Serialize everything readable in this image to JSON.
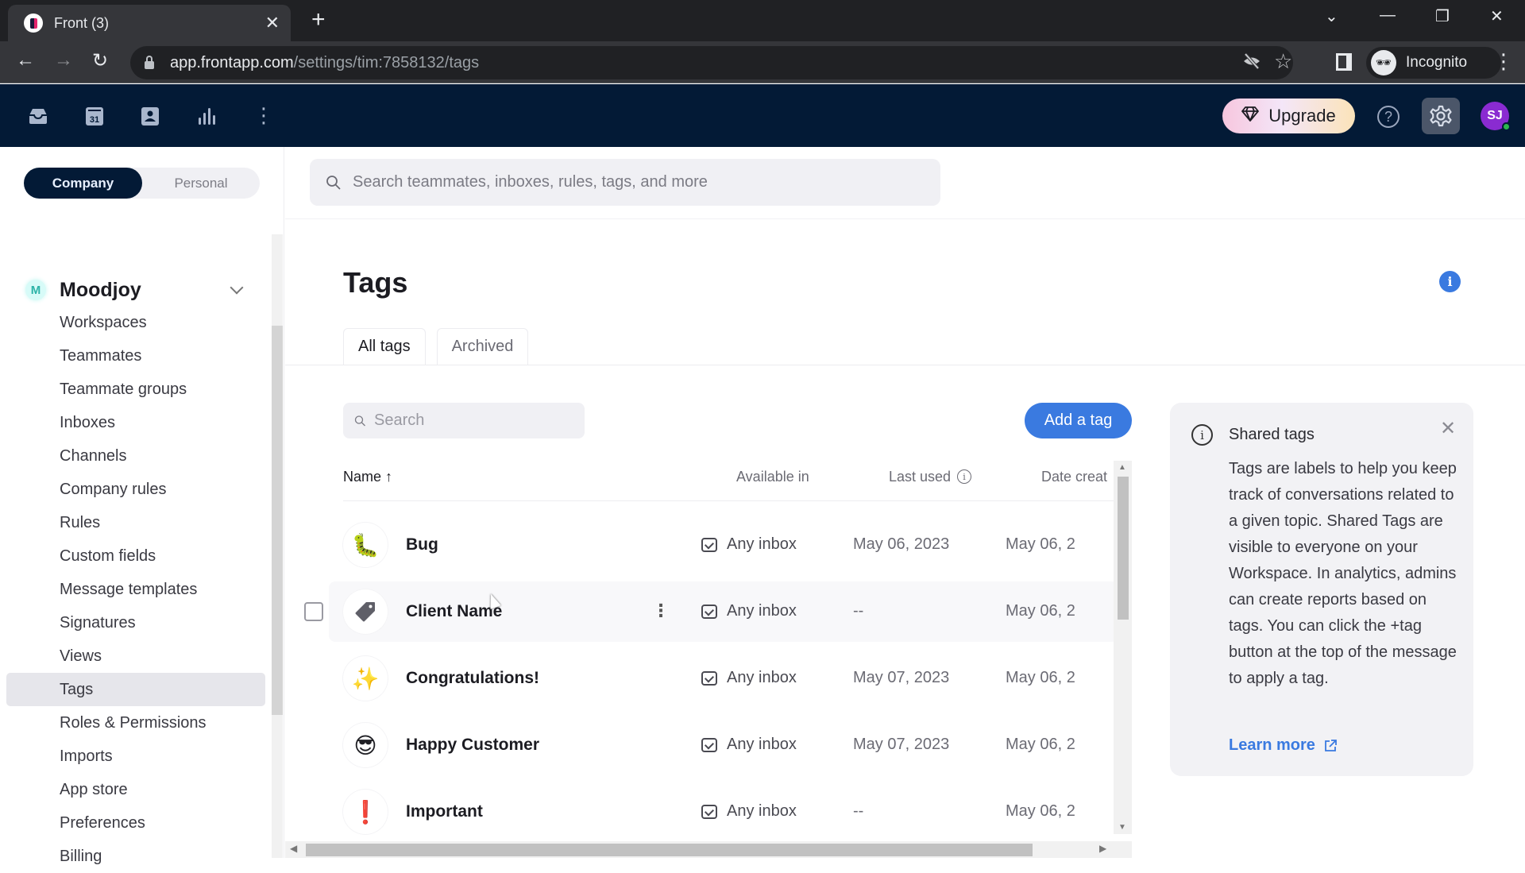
{
  "browser": {
    "tab_title": "Front (3)",
    "url_host": "app.frontapp.com",
    "url_path": "/settings/tim:7858132/tags",
    "profile_label": "Incognito",
    "icons": [
      "back-arrow",
      "forward-arrow",
      "reload",
      "eye-off",
      "star",
      "side-panel",
      "incognito",
      "more-vert",
      "tab-search",
      "minimize",
      "restore",
      "close"
    ]
  },
  "app_header": {
    "nav_icons": [
      "inbox",
      "calendar",
      "contacts",
      "analytics",
      "more"
    ],
    "calendar_day": "31",
    "upgrade_label": "Upgrade",
    "help_icon": "?",
    "avatar_initials": "SJ",
    "avatar_color": "#8a2bd1",
    "presence_color": "#2db84d"
  },
  "sidebar": {
    "scope": {
      "company_label": "Company",
      "personal_label": "Personal",
      "selected": "Company"
    },
    "org": {
      "badge": "M",
      "name": "Moodjoy"
    },
    "items": [
      {
        "label": "Workspaces"
      },
      {
        "label": "Teammates"
      },
      {
        "label": "Teammate groups"
      },
      {
        "label": "Inboxes"
      },
      {
        "label": "Channels"
      },
      {
        "label": "Company rules"
      },
      {
        "label": "Rules"
      },
      {
        "label": "Custom fields"
      },
      {
        "label": "Message templates"
      },
      {
        "label": "Signatures"
      },
      {
        "label": "Views"
      },
      {
        "label": "Tags",
        "active": true
      },
      {
        "label": "Roles & Permissions"
      },
      {
        "label": "Imports"
      },
      {
        "label": "App store"
      },
      {
        "label": "Preferences"
      },
      {
        "label": "Billing"
      }
    ]
  },
  "main": {
    "global_search_placeholder": "Search teammates, inboxes, rules, tags, and more",
    "title": "Tags",
    "tabs": [
      {
        "label": "All tags",
        "active": true
      },
      {
        "label": "Archived",
        "active": false
      }
    ],
    "tag_search_placeholder": "Search",
    "add_button_label": "Add a tag",
    "accent_color": "#3a7ae0",
    "table": {
      "columns": {
        "name": "Name ↑",
        "available_in": "Available in",
        "last_used": "Last used",
        "date_created": "Date creat"
      },
      "rows": [
        {
          "emoji": "🐛",
          "name": "Bug",
          "available_in": "Any inbox",
          "last_used": "May 06, 2023",
          "date_created": "May 06, 2"
        },
        {
          "emoji": "🏷",
          "name": "Client Name",
          "available_in": "Any inbox",
          "last_used": "--",
          "date_created": "May 06, 2",
          "hovered": true
        },
        {
          "emoji": "✨",
          "name": "Congratulations!",
          "available_in": "Any inbox",
          "last_used": "May 07, 2023",
          "date_created": "May 06, 2"
        },
        {
          "emoji": "😎",
          "name": "Happy Customer",
          "available_in": "Any inbox",
          "last_used": "May 07, 2023",
          "date_created": "May 06, 2"
        },
        {
          "emoji": "❗",
          "name": "Important",
          "available_in": "Any inbox",
          "last_used": "--",
          "date_created": "May 06, 2"
        }
      ]
    },
    "info_card": {
      "title": "Shared tags",
      "body": "Tags are labels to help you keep track of conversations related to a given topic. Shared Tags are visible to everyone on your Workspace. In analytics, admins can create reports based on tags. You can click the +tag button at the top of the message to apply a tag.",
      "link_label": "Learn more"
    }
  }
}
